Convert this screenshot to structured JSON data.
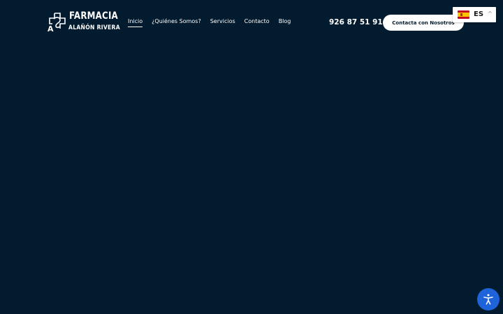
{
  "logo": {
    "line1": "FARMACIA",
    "line2": "ALAÑÓN RIVERA",
    "initial": "A"
  },
  "nav": {
    "items": [
      {
        "label": "Inicio",
        "active": true
      },
      {
        "label": "¿Quiénes Somos?",
        "active": false
      },
      {
        "label": "Servicios",
        "active": false
      },
      {
        "label": "Contacto",
        "active": false
      },
      {
        "label": "Blog",
        "active": false
      }
    ]
  },
  "header": {
    "phone": "926 87 51 91",
    "cta_label": "Contacta con Nosotros"
  },
  "language": {
    "code": "ES",
    "flag": "spain-flag",
    "caret": "^"
  },
  "accessibility": {
    "icon": "accessibility-icon"
  },
  "colors": {
    "background": "#021b2e",
    "accent_button": "#1e63d9",
    "cta_bg": "#ffffff"
  }
}
